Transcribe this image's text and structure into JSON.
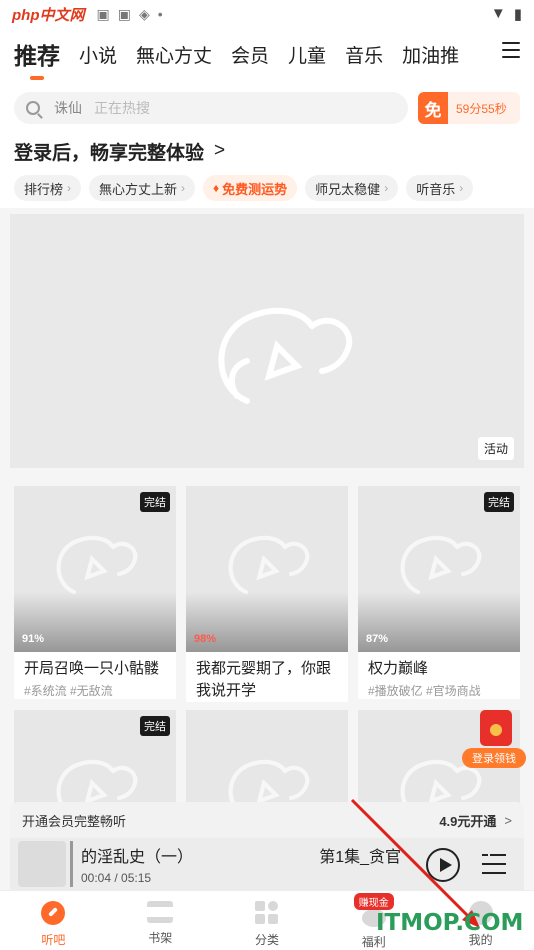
{
  "status_bar": {
    "watermark": "php中文网",
    "icons": [
      "gallery-icon",
      "gallery-icon",
      "compass-icon"
    ],
    "dot": "•"
  },
  "top_nav": {
    "tabs": [
      "推荐",
      "小说",
      "無心方丈",
      "会员",
      "儿童",
      "音乐",
      "加油推"
    ],
    "active_index": 0,
    "menu_icon": "hamburger-icon"
  },
  "search": {
    "keyword": "诛仙",
    "placeholder": "正在热搜"
  },
  "free_timer": {
    "badge": "免",
    "countdown": "59分55秒"
  },
  "login_prompt": {
    "text": "登录后，畅享完整体验",
    "arrow": ">"
  },
  "chips": [
    {
      "label": "排行榜",
      "hot": false
    },
    {
      "label": "無心方丈上新",
      "hot": false
    },
    {
      "label": "免费测运势",
      "hot": true
    },
    {
      "label": "师兄太稳健",
      "hot": false
    },
    {
      "label": "听音乐",
      "hot": false
    }
  ],
  "banner": {
    "tag": "活动"
  },
  "cards": [
    {
      "title": "开局召唤一只小骷髅",
      "tags": "#系统流 #无敌流",
      "pct": "91%",
      "done": "完结",
      "pct_red": false
    },
    {
      "title": "我都元婴期了，你跟我说开学",
      "tags": "",
      "pct": "98%",
      "done": "",
      "pct_red": true
    },
    {
      "title": "权力巅峰",
      "tags": "#播放破亿 #官场商战",
      "pct": "87%",
      "done": "完结",
      "pct_red": false
    },
    {
      "title": "",
      "tags": "",
      "pct": "",
      "done": "完结",
      "pct_red": false
    },
    {
      "title": "",
      "tags": "",
      "pct": "",
      "done": "",
      "pct_red": false
    },
    {
      "title": "",
      "tags": "",
      "pct": "",
      "done": "",
      "pct_red": false
    }
  ],
  "red_envelope": {
    "label": "登录领钱"
  },
  "vip_bar": {
    "text": "开通会员完整畅听",
    "price": "4.9元开通",
    "chevron": ">"
  },
  "player": {
    "track": "的淫乱史（一）",
    "episode": "第1集_贪官",
    "time": "00:04 / 05:15"
  },
  "bottom_nav": [
    {
      "label": "听吧",
      "icon": "leaf-icon",
      "active": true,
      "bubble": ""
    },
    {
      "label": "书架",
      "icon": "bookshelf-icon",
      "active": false,
      "bubble": ""
    },
    {
      "label": "分类",
      "icon": "category-icon",
      "active": false,
      "bubble": ""
    },
    {
      "label": "福利",
      "icon": "gift-icon",
      "active": false,
      "bubble": "赚现金"
    },
    {
      "label": "我的",
      "icon": "user-icon",
      "active": false,
      "bubble": ""
    }
  ],
  "watermark_bottom": "ITMOP.COM",
  "colors": {
    "accent": "#ff6a2a",
    "red": "#e8302a",
    "watermark_green": "#2a9d5a",
    "arrow_red": "#e0201a"
  }
}
